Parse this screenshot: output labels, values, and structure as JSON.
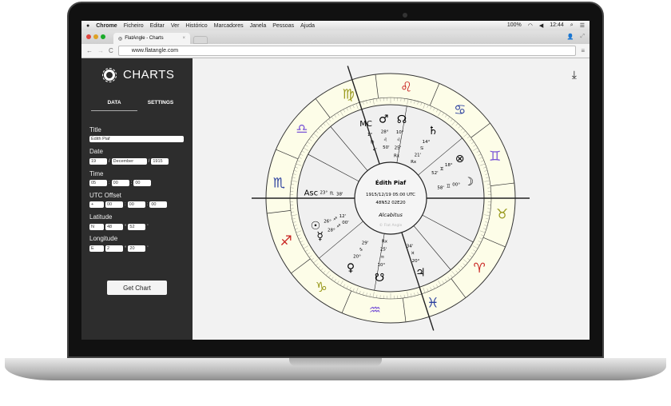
{
  "menubar": {
    "app": "Chrome",
    "items": [
      "Ficheiro",
      "Editar",
      "Ver",
      "Histórico",
      "Marcadores",
      "Janela",
      "Pessoas",
      "Ajuda"
    ],
    "battery": "100%",
    "time": "12:44"
  },
  "browser": {
    "tab_title": "FlatAngle - Charts",
    "url": "www.flatangle.com"
  },
  "sidebar": {
    "brand": "CHARTS",
    "tabs": [
      "DATA",
      "SETTINGS"
    ],
    "title_label": "Title",
    "title_value": "Édith Piaf",
    "date_label": "Date",
    "day": "19",
    "month": "December",
    "year": "1915",
    "time_label": "Time",
    "hour": "05",
    "minute": "00",
    "second": "00",
    "utc_label": "UTC Offset",
    "utc_sign": "+",
    "utc_h": "00",
    "utc_m": "00",
    "utc_s": "00",
    "lat_label": "Latitude",
    "lat_dir": "N",
    "lat_deg": "48",
    "lat_min": "52",
    "lon_label": "Longitude",
    "lon_dir": "E",
    "lon_deg": "2",
    "lon_min": "20",
    "submit": "Get Chart"
  },
  "chart": {
    "name": "Édith Piaf",
    "datetime": "1915/12/19 05:00 UTC",
    "coords": "48N52 02E20",
    "system": "Alcabitus",
    "watermark": "© Flat Angle",
    "signs": [
      {
        "n": "scorpio",
        "g": "♏",
        "c": "#2a3f9e"
      },
      {
        "n": "sagittarius",
        "g": "♐",
        "c": "#c8201e"
      },
      {
        "n": "capricorn",
        "g": "♑",
        "c": "#9a9a1e"
      },
      {
        "n": "aquarius",
        "g": "♒",
        "c": "#7a55d6"
      },
      {
        "n": "pisces",
        "g": "♓",
        "c": "#2a3f9e"
      },
      {
        "n": "aries",
        "g": "♈",
        "c": "#c8201e"
      },
      {
        "n": "taurus",
        "g": "♉",
        "c": "#9a9a1e"
      },
      {
        "n": "gemini",
        "g": "♊",
        "c": "#7a55d6"
      },
      {
        "n": "cancer",
        "g": "♋",
        "c": "#2a3f9e"
      },
      {
        "n": "leo",
        "g": "♌",
        "c": "#c8201e"
      },
      {
        "n": "virgo",
        "g": "♍",
        "c": "#9a9a1e"
      },
      {
        "n": "libra",
        "g": "♎",
        "c": "#7a55d6"
      }
    ],
    "points": [
      {
        "n": "mc",
        "g": "MC",
        "lines": [
          "1°",
          "♍",
          "4'"
        ]
      },
      {
        "n": "mars",
        "g": "♂",
        "lines": [
          "28°",
          "♌",
          "50'"
        ]
      },
      {
        "n": "north-node",
        "g": "☊",
        "lines": [
          "10°",
          "♌",
          "25'",
          "Rx"
        ]
      },
      {
        "n": "saturn",
        "g": "♄",
        "lines": [
          "14°",
          "♋",
          "21'",
          "Rx"
        ]
      },
      {
        "n": "fortune",
        "g": "⊗",
        "lines": [
          "18°",
          "♊",
          "52'"
        ]
      },
      {
        "n": "moon",
        "g": "☽",
        "lines": [
          "00°",
          "♊",
          "58'"
        ]
      },
      {
        "n": "asc",
        "g": "Asc",
        "lines": [
          "23°",
          "♏",
          "38'"
        ]
      },
      {
        "n": "sun",
        "g": "☉",
        "lines": [
          "26°",
          "♐",
          "12'"
        ]
      },
      {
        "n": "mercury",
        "g": "☿",
        "lines": [
          "28°",
          "♐",
          "00'"
        ]
      },
      {
        "n": "venus",
        "g": "♀",
        "lines": [
          "20°",
          "♑",
          "29'"
        ]
      },
      {
        "n": "south-node",
        "g": "☋",
        "lines": [
          "10°",
          "♒",
          "25'",
          "Rx"
        ]
      },
      {
        "n": "jupiter",
        "g": "♃",
        "lines": [
          "20°",
          "♓",
          "34'"
        ]
      }
    ]
  }
}
